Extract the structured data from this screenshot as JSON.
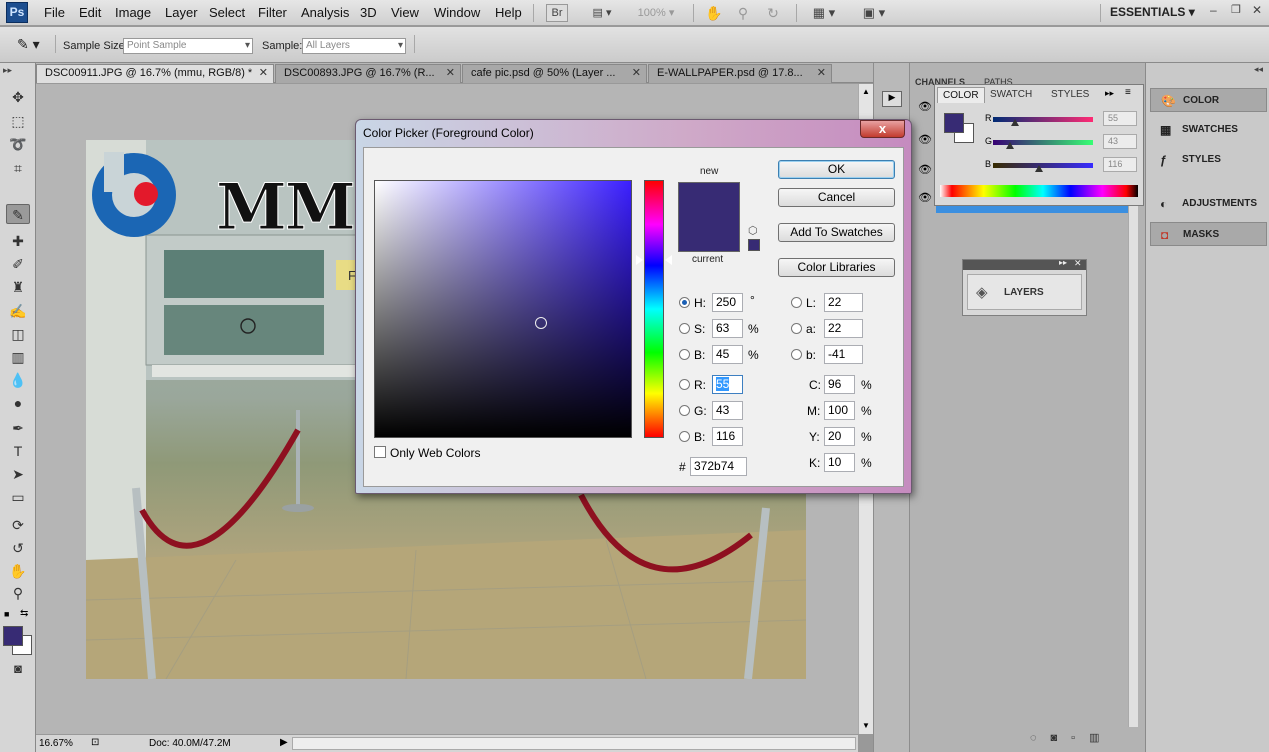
{
  "app": {
    "logo": "Ps"
  },
  "menu": [
    "File",
    "Edit",
    "Image",
    "Layer",
    "Select",
    "Filter",
    "Analysis",
    "3D",
    "View",
    "Window",
    "Help"
  ],
  "menubar_extras": {
    "bridge": "Br",
    "zoom": "100%",
    "workspace": "ESSENTIALS"
  },
  "options": {
    "sample_size_label": "Sample Size:",
    "sample_size_value": "Point Sample",
    "sample_label": "Sample:",
    "sample_value": "All Layers"
  },
  "tabs": [
    {
      "label": "DSC00911.JPG @ 16.7% (mmu, RGB/8) *",
      "active": true
    },
    {
      "label": "DSC00893.JPG @ 16.7% (R...",
      "active": false
    },
    {
      "label": "cafe pic.psd @ 50% (Layer ...",
      "active": false
    },
    {
      "label": "E-WALLPAPER.psd @ 17.8...",
      "active": false
    }
  ],
  "status": {
    "zoom": "16.67%",
    "doc": "Doc: 40.0M/47.2M"
  },
  "photo": {
    "logo_text": "MM",
    "sign_text": "F"
  },
  "dialog": {
    "title": "Color Picker (Foreground Color)",
    "close": "x",
    "new_label": "new",
    "current_label": "current",
    "new_color": "#372b74",
    "current_color": "#372b74",
    "buttons": {
      "ok": "OK",
      "cancel": "Cancel",
      "add": "Add To Swatches",
      "libraries": "Color Libraries"
    },
    "hsb": {
      "h": "250",
      "s": "63",
      "b": "45",
      "h_unit": "°",
      "s_unit": "%",
      "b_unit": "%"
    },
    "rgb": {
      "r": "55",
      "g": "43",
      "b": "116"
    },
    "lab": {
      "l": "22",
      "a": "22",
      "b": "-41"
    },
    "cmyk": {
      "c": "96",
      "m": "100",
      "y": "20",
      "k": "10",
      "unit": "%"
    },
    "hex": "372b74",
    "labels": {
      "h": "H:",
      "s": "S:",
      "b": "B:",
      "r": "R:",
      "g": "G:",
      "bb": "B:",
      "l": "L:",
      "a": "a:",
      "lb": "b:",
      "c": "C:",
      "m": "M:",
      "y": "Y:",
      "k": "K:",
      "hash": "#"
    },
    "only_web": "Only Web Colors"
  },
  "color_panel": {
    "tabs": [
      "COLOR",
      "SWATCH",
      "STYLES"
    ],
    "channels_tab": "CHANNELS",
    "paths_tab": "PATHS",
    "r_label": "R",
    "g_label": "G",
    "b_label": "B",
    "r": "55",
    "g": "43",
    "b": "116",
    "r_fraction": 0.216,
    "g_fraction": 0.169,
    "b_fraction": 0.455
  },
  "dock": {
    "color": "COLOR",
    "swatches": "SWATCHES",
    "styles": "STYLES",
    "adjustments": "ADJUSTMENTS",
    "masks": "MASKS"
  },
  "layers_float": {
    "label": "LAYERS"
  },
  "colors": {
    "foreground": "#372b74",
    "background": "#ffffff"
  }
}
